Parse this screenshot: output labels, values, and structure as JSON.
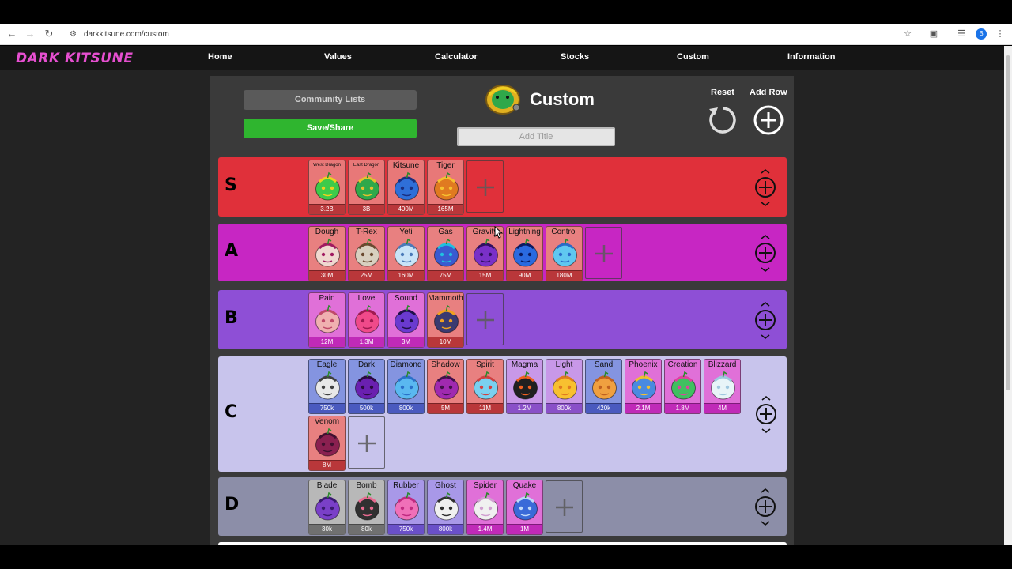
{
  "browser": {
    "url": "darkkitsune.com/custom",
    "profile_initial": "B"
  },
  "site": {
    "logo": "DARK KITSUNE",
    "nav": [
      "Home",
      "Values",
      "Calculator",
      "Stocks",
      "Custom",
      "Information"
    ]
  },
  "page": {
    "community_label": "Community Lists",
    "save_label": "Save/Share",
    "title": "Custom",
    "title_placeholder": "Add Title",
    "reset_label": "Reset",
    "addrow_label": "Add Row"
  },
  "tiers": [
    {
      "label": "S",
      "color": "#e0303a",
      "items": [
        {
          "name": "West Dragon",
          "value": "3.2B",
          "small": true,
          "bg": "#e87878",
          "bar": "#b9373a",
          "art": "#3ecb4a",
          "art2": "#f0d020"
        },
        {
          "name": "East Dragon",
          "value": "3B",
          "small": true,
          "bg": "#e87878",
          "bar": "#b9373a",
          "art": "#2fa84a",
          "art2": "#e6c030"
        },
        {
          "name": "Kitsune",
          "value": "400M",
          "bg": "#e87878",
          "bar": "#b9373a",
          "art": "#2f6fd8",
          "art2": "#1a2f80"
        },
        {
          "name": "Tiger",
          "value": "165M",
          "bg": "#e87878",
          "bar": "#b9373a",
          "art": "#e07a20",
          "art2": "#f6c030"
        }
      ]
    },
    {
      "label": "A",
      "color": "#c726c3",
      "items": [
        {
          "name": "Dough",
          "value": "30M",
          "bg": "#e88080",
          "bar": "#b9373a",
          "art": "#f0d8d0",
          "art2": "#a01a60"
        },
        {
          "name": "T-Rex",
          "value": "25M",
          "bg": "#e88080",
          "bar": "#b9373a",
          "art": "#d8d0c0",
          "art2": "#6a4a30"
        },
        {
          "name": "Yeti",
          "value": "160M",
          "bg": "#e88080",
          "bar": "#b9373a",
          "art": "#c8e4f8",
          "art2": "#4a7ab8"
        },
        {
          "name": "Gas",
          "value": "75M",
          "bg": "#e88080",
          "bar": "#b9373a",
          "art": "#3a5ad0",
          "art2": "#20c0e0"
        },
        {
          "name": "Gravity",
          "value": "15M",
          "bg": "#e88080",
          "bar": "#b9373a",
          "art": "#7a30c8",
          "art2": "#301060"
        },
        {
          "name": "Lightning",
          "value": "90M",
          "bg": "#e88080",
          "bar": "#b9373a",
          "art": "#2a6ae0",
          "art2": "#0a1a60"
        },
        {
          "name": "Control",
          "value": "180M",
          "bg": "#e88080",
          "bar": "#b9373a",
          "art": "#60c8f0",
          "art2": "#2a6ac8"
        }
      ]
    },
    {
      "label": "B",
      "color": "#8e4fd6",
      "items": [
        {
          "name": "Pain",
          "value": "12M",
          "bg": "#e070d8",
          "bar": "#c02ab8",
          "art": "#f0b0b0",
          "art2": "#c04a6a"
        },
        {
          "name": "Love",
          "value": "1.3M",
          "bg": "#e070d8",
          "bar": "#c02ab8",
          "art": "#f04a8a",
          "art2": "#a01a50"
        },
        {
          "name": "Sound",
          "value": "3M",
          "bg": "#e070d8",
          "bar": "#c02ab8",
          "art": "#6a3ad0",
          "art2": "#20104a"
        },
        {
          "name": "Mammoth",
          "value": "10M",
          "bg": "#e88080",
          "bar": "#b9373a",
          "art": "#3a3a70",
          "art2": "#f0a020"
        }
      ]
    },
    {
      "label": "C",
      "color": "#c8c4ec",
      "items": [
        {
          "name": "Eagle",
          "value": "750k",
          "bg": "#8494e0",
          "bar": "#4a5abf",
          "art": "#e8e8e8",
          "art2": "#404040"
        },
        {
          "name": "Dark",
          "value": "500k",
          "bg": "#8494e0",
          "bar": "#4a5abf",
          "art": "#6a20b0",
          "art2": "#2a0a40"
        },
        {
          "name": "Diamond",
          "value": "800k",
          "bg": "#8494e0",
          "bar": "#4a5abf",
          "art": "#5ab8f0",
          "art2": "#2a70c8"
        },
        {
          "name": "Shadow",
          "value": "5M",
          "bg": "#e88080",
          "bar": "#b9373a",
          "art": "#a02ab0",
          "art2": "#40104a"
        },
        {
          "name": "Spirit",
          "value": "11M",
          "bg": "#e88080",
          "bar": "#b9373a",
          "art": "#7ad0f0",
          "art2": "#d04040"
        },
        {
          "name": "Magma",
          "value": "1.2M",
          "bg": "#c898e8",
          "bar": "#8a50c8",
          "art": "#202020",
          "art2": "#f06020"
        },
        {
          "name": "Light",
          "value": "800k",
          "bg": "#c898e8",
          "bar": "#8a50c8",
          "art": "#f8c030",
          "art2": "#e07a20"
        },
        {
          "name": "Sand",
          "value": "420k",
          "bg": "#8494e0",
          "bar": "#4a5abf",
          "art": "#f0a040",
          "art2": "#c06020"
        },
        {
          "name": "Phoenix",
          "value": "2.1M",
          "bg": "#e070d8",
          "bar": "#c02ab8",
          "art": "#4a8ae0",
          "art2": "#f0c030"
        },
        {
          "name": "Creation",
          "value": "1.8M",
          "bg": "#e070d8",
          "bar": "#c02ab8",
          "art": "#40c060",
          "art2": "#e040a0"
        },
        {
          "name": "Blizzard",
          "value": "4M",
          "bg": "#e070d8",
          "bar": "#c02ab8",
          "art": "#e8f4f8",
          "art2": "#a0c8e0"
        },
        {
          "name": "Venom",
          "value": "8M",
          "bg": "#e88080",
          "bar": "#b9373a",
          "art": "#8a2050",
          "art2": "#401030"
        }
      ]
    },
    {
      "label": "D",
      "color": "#8c8ea8",
      "items": [
        {
          "name": "Blade",
          "value": "30k",
          "bg": "#b8b8b8",
          "bar": "#707070",
          "art": "#7a40c8",
          "art2": "#3a1a70"
        },
        {
          "name": "Bomb",
          "value": "80k",
          "bg": "#b8b8b8",
          "bar": "#707070",
          "art": "#303030",
          "art2": "#e86a90"
        },
        {
          "name": "Rubber",
          "value": "750k",
          "bg": "#a898e8",
          "bar": "#6a50c8",
          "art": "#f070b8",
          "art2": "#c02a80"
        },
        {
          "name": "Ghost",
          "value": "800k",
          "bg": "#a898e8",
          "bar": "#6a50c8",
          "art": "#f0f0f0",
          "art2": "#303030"
        },
        {
          "name": "Spider",
          "value": "1.4M",
          "bg": "#e070d8",
          "bar": "#c02ab8",
          "art": "#f0f0f0",
          "art2": "#d0a0d0"
        },
        {
          "name": "Quake",
          "value": "1M",
          "bg": "#e070d8",
          "bar": "#c02ab8",
          "art": "#3a6ad8",
          "art2": "#c0d8f8"
        }
      ]
    }
  ]
}
